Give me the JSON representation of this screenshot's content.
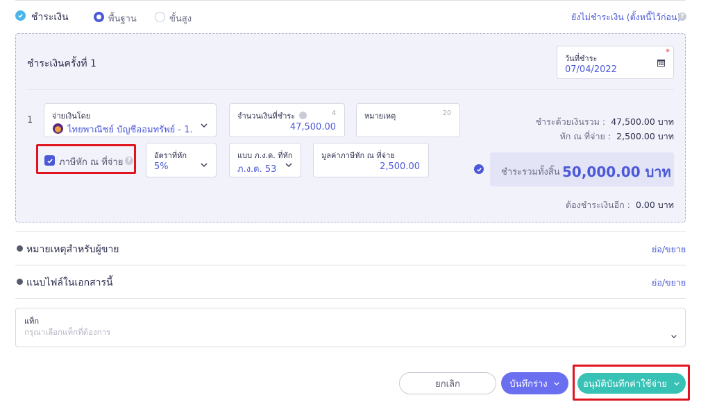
{
  "header": {
    "title": "ชำระเงิน",
    "mode_basic": "พื้นฐาน",
    "mode_advanced": "ขั้นสูง",
    "unpaid_link": "ยังไม่ชำระเงิน (ตั้งหนี้ไว้ก่อน)"
  },
  "payment": {
    "round_title": "ชำระเงินครั้งที่ 1",
    "pay_date_label": "วันที่ชำระ",
    "pay_date_value": "07/04/2022",
    "row_number": "1",
    "pay_by_label": "จ่ายเงินโดย",
    "pay_by_value": "ไทยพาณิชย์ บัญชีออมทรัพย์ - 1...",
    "amount_label": "จำนวนเงินที่ชำระ",
    "amount_count": "4",
    "amount_value": "47,500.00",
    "note_label": "หมายเหตุ",
    "note_count": "20",
    "withholding_label": "ภาษีหัก ณ ที่จ่าย",
    "withholding_checked": true,
    "rate_label": "อัตราที่หัก",
    "rate_value": "5%",
    "form_label": "แบบ ภ.ง.ด. ที่หัก",
    "form_value": "ภ.ง.ด. 53",
    "tax_amount_label": "มูลค่าภาษีหัก ณ ที่จ่าย",
    "tax_amount_value": "2,500.00"
  },
  "summary": {
    "cash_total_label": "ชำระด้วยเงินรวม :",
    "cash_total_value": "47,500.00 บาท",
    "withheld_label": "หัก ณ ที่จ่าย :",
    "withheld_value": "2,500.00 บาท",
    "grand_total_label": "ชำระรวมทั้งสิ้น",
    "grand_total_value": "50,000.00 บาท",
    "remaining_label": "ต้องชำระเงินอีก :",
    "remaining_value": "0.00 บาท"
  },
  "sections": {
    "vendor_note_title": "หมายเหตุสำหรับผู้ขาย",
    "attach_title": "แนบไฟล์ในเอกสารนี้",
    "toggle_label": "ย่อ/ขยาย"
  },
  "tags": {
    "label": "แท็ก",
    "placeholder": "กรุณาเลือกแท็กที่ต้องการ"
  },
  "actions": {
    "cancel": "ยกเลิก",
    "save_draft": "บันทึกร่าง",
    "approve": "อนุมัติบันทึกค่าใช้จ่าย"
  },
  "colors": {
    "accent": "#4b59d8",
    "approve": "#38c1b5",
    "draft": "#6a6ff0",
    "highlight": "#e0141e"
  }
}
